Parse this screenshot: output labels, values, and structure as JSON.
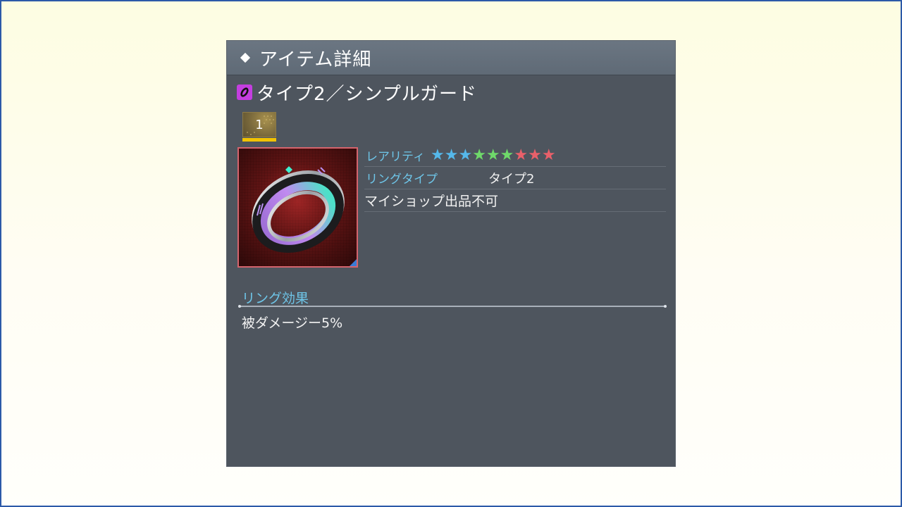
{
  "header": {
    "title": "アイテム詳細",
    "icon": "diamond-icon"
  },
  "item": {
    "name": "タイプ2／シンプルガード",
    "type_icon": "ring-icon",
    "type_icon_color": "#c43ee0",
    "quantity": "1"
  },
  "properties": {
    "rarity_label": "レアリティ",
    "rarity_stars": [
      {
        "color": "#55b8ea"
      },
      {
        "color": "#55b8ea"
      },
      {
        "color": "#55b8ea"
      },
      {
        "color": "#6fd96a"
      },
      {
        "color": "#6fd96a"
      },
      {
        "color": "#6fd96a"
      },
      {
        "color": "#e9606a"
      },
      {
        "color": "#e9606a"
      },
      {
        "color": "#e9606a"
      }
    ],
    "ring_type_label": "リングタイプ",
    "ring_type_value": "タイプ2",
    "shop_note": "マイショップ出品不可"
  },
  "effect": {
    "title": "リング効果",
    "text": "被ダメージー5%"
  },
  "colors": {
    "panel_bg": "#4e555e",
    "header_bg": "#65707c",
    "label_blue": "#6ec5e8",
    "image_border": "#d4646d",
    "quantity_bar": "#f2c200"
  }
}
